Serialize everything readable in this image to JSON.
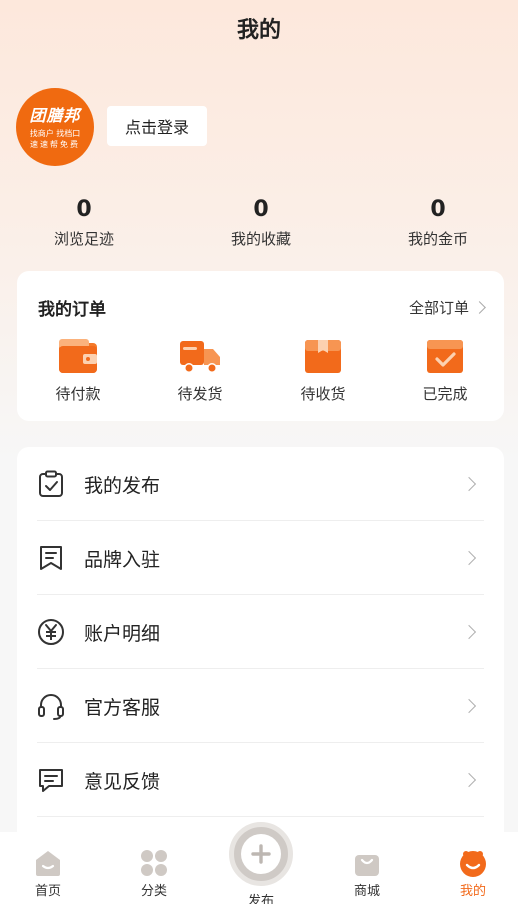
{
  "header": {
    "title": "我的"
  },
  "profile": {
    "logo_main": "团膳邦",
    "logo_line1": "找商户 找档口",
    "logo_line2": "速速帮免费",
    "login_label": "点击登录"
  },
  "stats": [
    {
      "value": "0",
      "label": "浏览足迹"
    },
    {
      "value": "0",
      "label": "我的收藏"
    },
    {
      "value": "0",
      "label": "我的金币"
    }
  ],
  "orders": {
    "title": "我的订单",
    "all_label": "全部订单",
    "items": [
      {
        "label": "待付款",
        "icon": "wallet-icon"
      },
      {
        "label": "待发货",
        "icon": "truck-icon"
      },
      {
        "label": "待收货",
        "icon": "package-icon"
      },
      {
        "label": "已完成",
        "icon": "completed-box-icon"
      }
    ]
  },
  "menu": [
    {
      "label": "我的发布",
      "icon": "clipboard-check-icon"
    },
    {
      "label": "品牌入驻",
      "icon": "bookmark-icon"
    },
    {
      "label": "账户明细",
      "icon": "yuan-icon"
    },
    {
      "label": "官方客服",
      "icon": "headset-icon"
    },
    {
      "label": "意见反馈",
      "icon": "chat-icon"
    }
  ],
  "tabs": [
    {
      "label": "首页",
      "icon": "home-icon"
    },
    {
      "label": "分类",
      "icon": "category-icon"
    },
    {
      "label": "发布",
      "icon": "plus-icon"
    },
    {
      "label": "商城",
      "icon": "shop-bag-icon"
    },
    {
      "label": "我的",
      "icon": "profile-face-icon"
    }
  ],
  "colors": {
    "accent": "#f26a1b",
    "tab_inactive_icon": "#cfc9c4"
  }
}
